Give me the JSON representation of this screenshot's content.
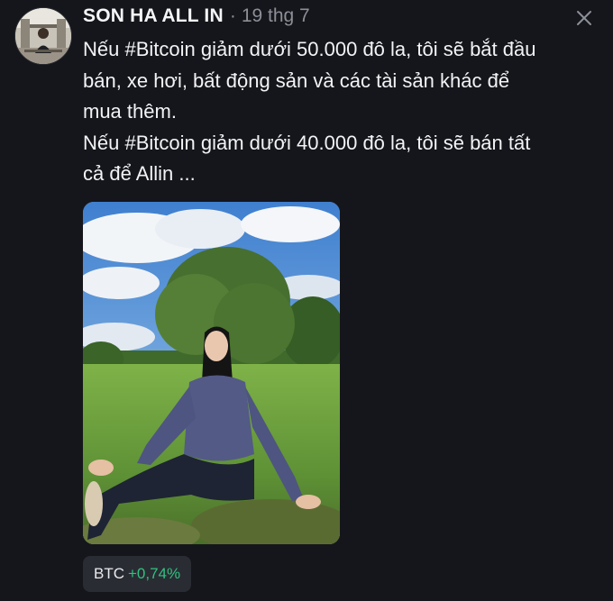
{
  "post": {
    "author": "SON HA ALL IN",
    "separator": "·",
    "date": "19 thg 7",
    "lines": [
      "Nếu #Bitcoin giảm dưới 50.000 đô la, tôi sẽ bắt đầu",
      "bán, xe hơi, bất động sản và các tài sản khác để",
      "mua thêm.",
      "Nếu #Bitcoin giảm dưới 40.000 đô la, tôi sẽ bán tất",
      "cả để Allin ..."
    ],
    "avatar_icon": "profile-avatar",
    "close_icon": "close-icon"
  },
  "ticker": {
    "symbol": "BTC",
    "change": "+0,74%",
    "change_color": "#2fc27f"
  },
  "colors": {
    "background": "#15161b",
    "text": "#f2f3f5",
    "muted": "#8c8f97",
    "ticker_bg": "#2a2c33"
  }
}
